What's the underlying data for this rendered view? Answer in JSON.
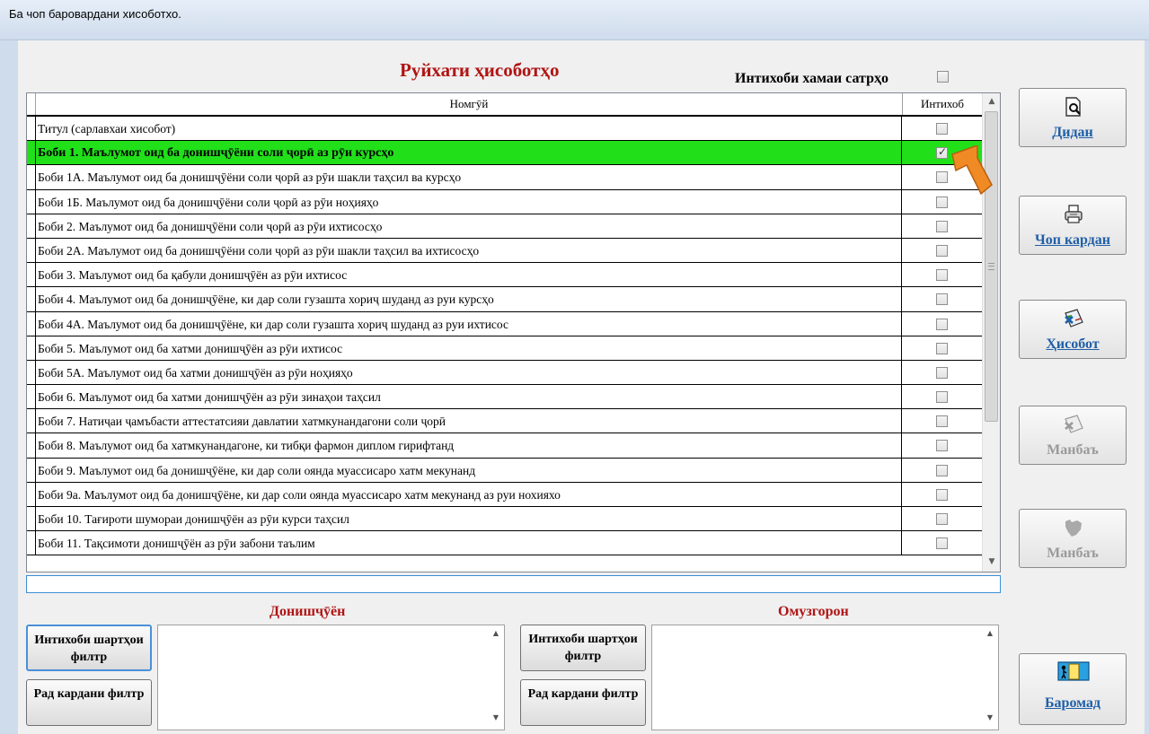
{
  "window": {
    "title": "Ба чоп баровардани хисоботхо."
  },
  "list": {
    "title": "Руйхати ҳисоботҳо",
    "select_all_label": "Интихоби хамаи сатрҳо",
    "select_all_checked": false,
    "col_name": "Номгӯй",
    "col_select": "Интихоб",
    "rows": [
      {
        "name": "Титул (сарлавхаи хисобот)",
        "checked": false,
        "active": false
      },
      {
        "name": "Боби 1. Маълумот оид ба донишҷӯёни соли ҷорӣ аз рӯи курсҳо",
        "checked": true,
        "active": true
      },
      {
        "name": "Боби 1А. Маълумот оид ба донишҷӯёни соли ҷорӣ аз рӯи шакли таҳсил ва курсҳо",
        "checked": false,
        "active": false
      },
      {
        "name": "Боби 1Б. Маълумот оид ба донишҷӯёни соли ҷорӣ аз рӯи ноҳияҳо",
        "checked": false,
        "active": false
      },
      {
        "name": "Боби 2. Маълумот оид ба донишҷӯёни соли ҷорӣ аз рӯи ихтисосҳо",
        "checked": false,
        "active": false
      },
      {
        "name": "Боби 2А. Маълумот оид ба донишҷӯёни соли ҷорӣ аз рӯи шакли таҳсил ва ихтисосҳо",
        "checked": false,
        "active": false
      },
      {
        "name": "Боби 3. Маълумот оид ба қабули донишҷӯён аз рӯи ихтисос",
        "checked": false,
        "active": false
      },
      {
        "name": "Боби 4. Маълумот оид ба донишҷӯёне, ки дар соли гузашта хориҷ шуданд аз руи курсҳо",
        "checked": false,
        "active": false
      },
      {
        "name": "Боби 4А. Маълумот оид ба донишҷӯёне, ки дар соли гузашта хориҷ шуданд аз руи ихтисос",
        "checked": false,
        "active": false
      },
      {
        "name": "Боби 5. Маълумот оид ба хатми донишҷӯён аз рӯи ихтисос",
        "checked": false,
        "active": false
      },
      {
        "name": "Боби 5А. Маълумот оид ба хатми донишҷӯён аз рӯи ноҳияҳо",
        "checked": false,
        "active": false
      },
      {
        "name": "Боби 6. Маълумот оид ба хатми донишҷӯён аз рӯи зинаҳои таҳсил",
        "checked": false,
        "active": false
      },
      {
        "name": "Боби 7. Натиҷаи ҷамъбасти аттестатсияи давлатии хатмкунандагони соли ҷорӣ",
        "checked": false,
        "active": false
      },
      {
        "name": "Боби 8. Маълумот оид ба хатмкунандагоне, ки тибқи фармон диплом гирифтанд",
        "checked": false,
        "active": false
      },
      {
        "name": "Боби 9. Маълумот оид ба донишҷӯёне, ки  дар соли оянда муассисаро хатм мекунанд",
        "checked": false,
        "active": false
      },
      {
        "name": "Боби 9а. Маълумот оид ба донишҷӯёне, ки  дар соли оянда муассисаро хатм мекунанд аз руи нохияхо",
        "checked": false,
        "active": false
      },
      {
        "name": "Боби 10. Тағироти шумораи донишҷӯён аз рӯи курси таҳсил",
        "checked": false,
        "active": false
      },
      {
        "name": "Боби 11. Тақсимоти донишҷӯён аз рӯи забони таълим",
        "checked": false,
        "active": false
      }
    ]
  },
  "side_buttons": {
    "view": "Дидан",
    "print": "Чоп кардан",
    "report": "Ҳисобот",
    "source1": "Манбаъ",
    "source2": "Манбаъ",
    "exit": "Баромад"
  },
  "students": {
    "title": "Донишҷӯён",
    "select_filter": "Интихоби шартҳои филтр",
    "clear_filter": "Рад кардани филтр"
  },
  "teachers": {
    "title": "Омузгорон",
    "select_filter": "Интихоби шартҳои филтр",
    "clear_filter": "Рад кардани филтр"
  },
  "colors": {
    "accent_title": "#b01414",
    "active_row": "#21e01a",
    "button_label": "#1f5fa8",
    "pointer": "#f08a24"
  },
  "icons": {
    "view": "magnifier-page-icon",
    "print": "printer-icon",
    "report": "excel-report-icon",
    "source1": "excel-disabled-icon",
    "source2": "map-disabled-icon",
    "exit": "door-exit-icon"
  }
}
